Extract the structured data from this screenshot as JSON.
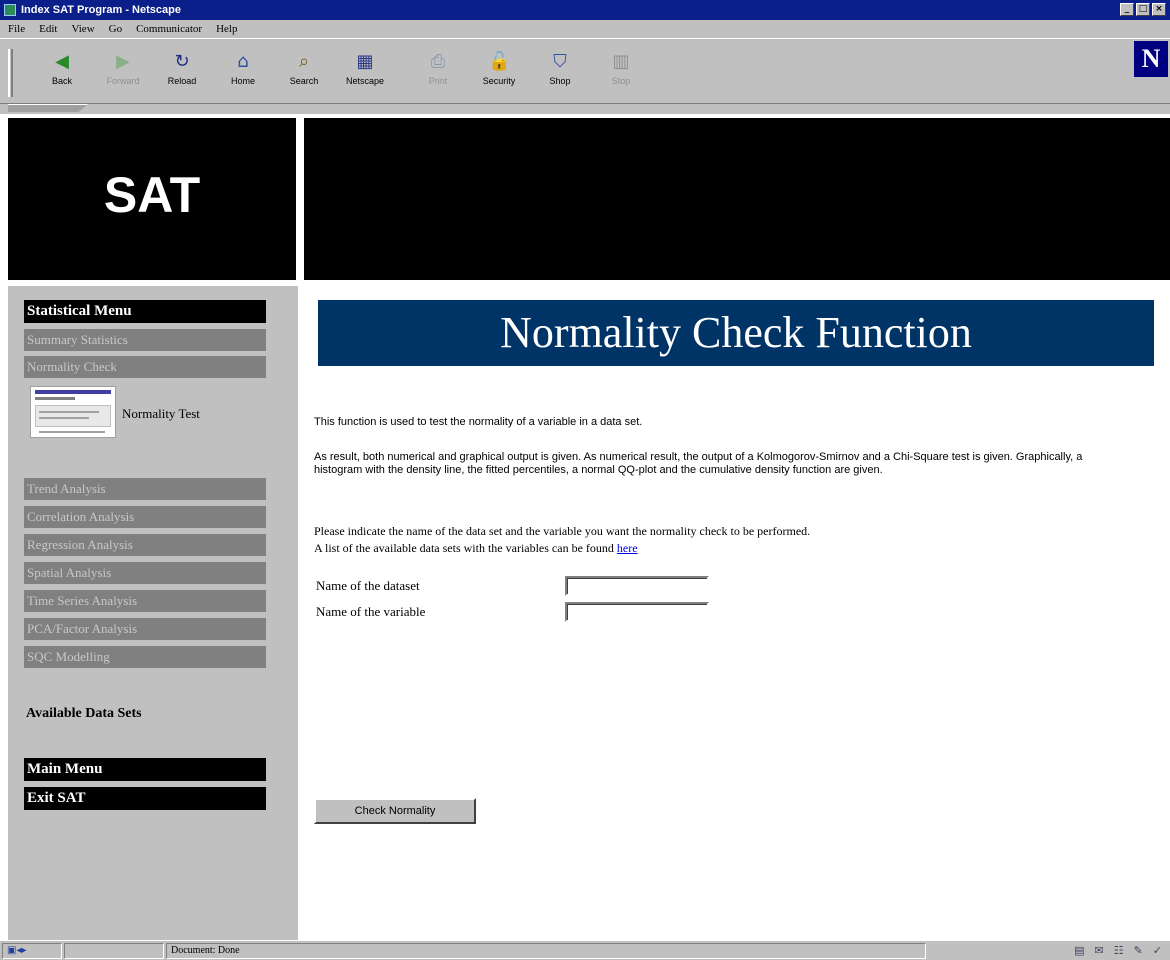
{
  "window": {
    "title": "Index SAT Program - Netscape",
    "controls": [
      "_",
      "□",
      "×"
    ]
  },
  "menubar": [
    "File",
    "Edit",
    "View",
    "Go",
    "Communicator",
    "Help"
  ],
  "toolbar": {
    "buttons": [
      {
        "label": "Back",
        "icon": "back-arrow-icon",
        "glyph": "◀"
      },
      {
        "label": "Forward",
        "icon": "forward-arrow-icon",
        "glyph": "▶"
      },
      {
        "label": "Reload",
        "icon": "reload-icon",
        "glyph": "↻"
      },
      {
        "label": "Home",
        "icon": "home-icon",
        "glyph": "⌂"
      },
      {
        "label": "Search",
        "icon": "search-icon",
        "glyph": "⌕"
      },
      {
        "label": "Netscape",
        "icon": "netscape-icon",
        "glyph": "▦"
      },
      {
        "label": "Print",
        "icon": "print-icon",
        "glyph": "⎙"
      },
      {
        "label": "Security",
        "icon": "security-lock-icon",
        "glyph": "🔓"
      },
      {
        "label": "Shop",
        "icon": "shop-bag-icon",
        "glyph": "⛉"
      },
      {
        "label": "Stop",
        "icon": "stop-icon",
        "glyph": "▥"
      }
    ],
    "logo": "N"
  },
  "logo": {
    "text": "SAT"
  },
  "sidebar": {
    "header": "Statistical Menu",
    "items_top": [
      "Summary Statistics",
      "Normality Check"
    ],
    "subitem": "Normality Test",
    "items_bottom": [
      "Trend Analysis",
      "Correlation Analysis",
      "Regression Analysis",
      "Spatial Analysis",
      "Time Series Analysis",
      "PCA/Factor Analysis",
      "SQC Modelling"
    ],
    "available_data_sets": "Available Data Sets",
    "main_menu": "Main Menu",
    "exit": "Exit SAT"
  },
  "main": {
    "title": "Normality Check Function",
    "para1": "This function is used to test the normality of a variable in a data set.",
    "para2": "As result, both numerical and graphical output is given. As numerical result, the output of a Kolmogorov-Smirnov and a Chi-Square test is given. Graphically, a histogram with the density line, the fitted percentiles, a normal QQ-plot and the cumulative density function are given.",
    "para3_line1": "Please indicate the name of the data set and the variable you want the normality check to be performed.",
    "para3_line2": "A list of the available data sets with the variables can be found",
    "here_link": "here",
    "dataset_label": "Name of the dataset",
    "variable_label": "Name of the variable",
    "dataset_value": "",
    "variable_value": "",
    "button": "Check Normality"
  },
  "statusbar": {
    "text": "Document: Done"
  }
}
